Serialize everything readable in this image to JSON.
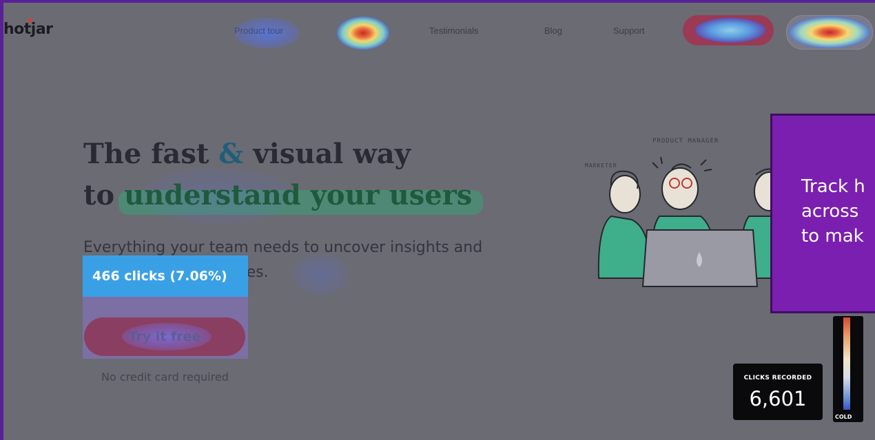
{
  "header": {
    "logo": "hotjar",
    "nav": [
      "Product tour",
      "Testimonials",
      "Blog",
      "Support"
    ]
  },
  "hero": {
    "headline_line1_a": "The fast ",
    "headline_line1_amp": "&",
    "headline_line1_b": " visual way",
    "headline_line2_a": "to ",
    "headline_line2_hl": "understand your users",
    "subtext": "Everything your team needs to uncover insights and make the right changes.",
    "cta_label": "Try it free",
    "no_credit_card": "No credit card required"
  },
  "heatmap": {
    "tooltip": "466 clicks (7.06%)",
    "clicks_recorded_label": "CLICKS RECORDED",
    "clicks_recorded_value": "6,601",
    "scale_cold_label": "COLD"
  },
  "illustration": {
    "label_product_manager": "PRODUCT MANAGER",
    "label_marketer": "MARKETER"
  },
  "callout": {
    "line1": "Track h",
    "line2": "across",
    "line3": "to mak"
  },
  "colors": {
    "frame_border": "#5a2196",
    "callout_bg": "#7b1fb0",
    "tooltip_bg": "#3aa0e6"
  }
}
